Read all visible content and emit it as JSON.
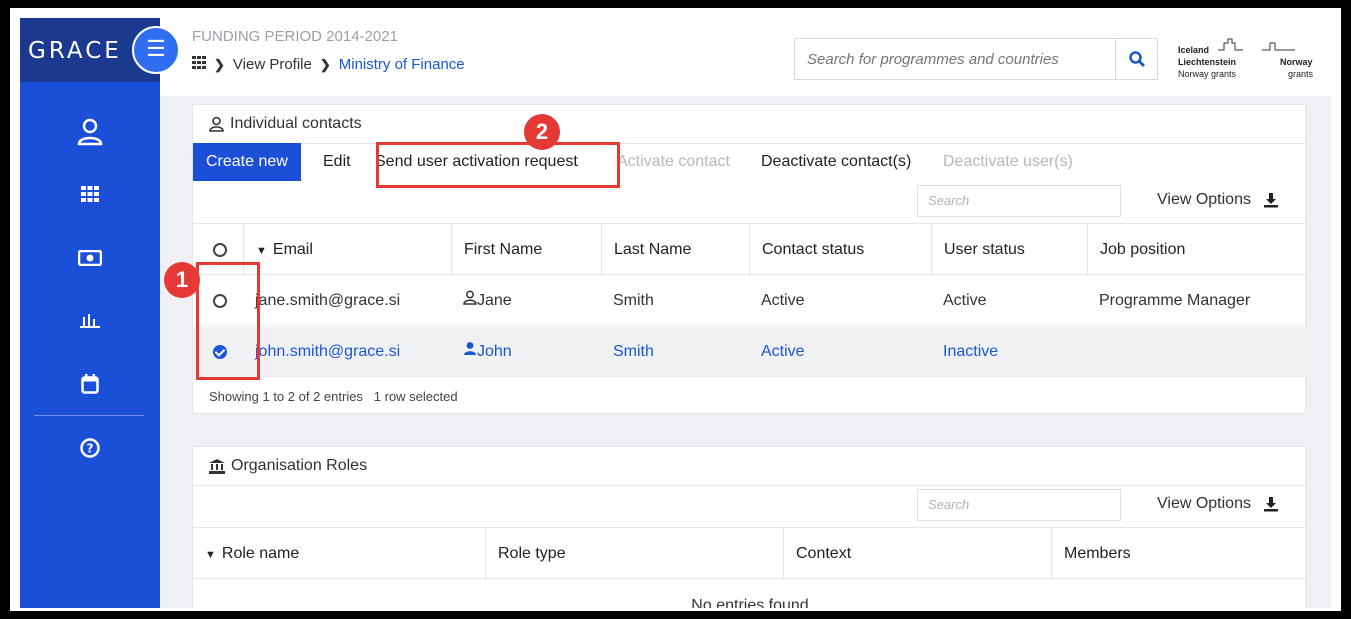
{
  "brand": {
    "name": "GRACE",
    "menu_glyph": "☰"
  },
  "header": {
    "funding_period": "FUNDING PERIOD 2014-2021",
    "breadcrumb": {
      "home_icon": "grid-icon",
      "view_profile": "View Profile",
      "ministry": "Ministry of Finance"
    },
    "search_placeholder": "Search for programmes and countries",
    "grants_logo": {
      "line1_left": "Iceland",
      "line2_left": "Liechtenstein",
      "line2_right": "Norway",
      "line3_left": "Norway grants",
      "line3_right": "grants"
    }
  },
  "sidebar": {
    "items": [
      {
        "icon": "user-icon"
      },
      {
        "icon": "grid-icon"
      },
      {
        "icon": "money-icon"
      },
      {
        "icon": "chart-icon"
      },
      {
        "icon": "calendar-icon"
      },
      {
        "icon": "help-icon"
      }
    ]
  },
  "contacts": {
    "title": "Individual contacts",
    "toolbar": {
      "create_new": "Create new",
      "edit": "Edit",
      "send_activation": "Send user activation request",
      "activate_contact": "Activate contact",
      "deactivate_contacts": "Deactivate contact(s)",
      "deactivate_users": "Deactivate user(s)"
    },
    "search_placeholder": "Search",
    "view_options": "View Options",
    "columns": [
      "Email",
      "First Name",
      "Last Name",
      "Contact status",
      "User status",
      "Job position"
    ],
    "rows": [
      {
        "email": "jane.smith@grace.si",
        "first": "Jane",
        "last": "Smith",
        "contact_status": "Active",
        "user_status": "Active",
        "job": "Programme Manager",
        "selected": false
      },
      {
        "email": "john.smith@grace.si",
        "first": "John",
        "last": "Smith",
        "contact_status": "Active",
        "user_status": "Inactive",
        "job": "",
        "selected": true
      }
    ],
    "footer_entries": "Showing 1 to 2 of 2 entries",
    "footer_selected": "1 row selected"
  },
  "roles": {
    "title": "Organisation Roles",
    "search_placeholder": "Search",
    "view_options": "View Options",
    "columns": [
      "Role name",
      "Role type",
      "Context",
      "Members"
    ],
    "empty": "No entries found"
  },
  "callouts": {
    "one": "1",
    "two": "2",
    "color": "#e53935"
  },
  "colors": {
    "accent": "#1b4fd8",
    "link": "#1a56d6"
  }
}
